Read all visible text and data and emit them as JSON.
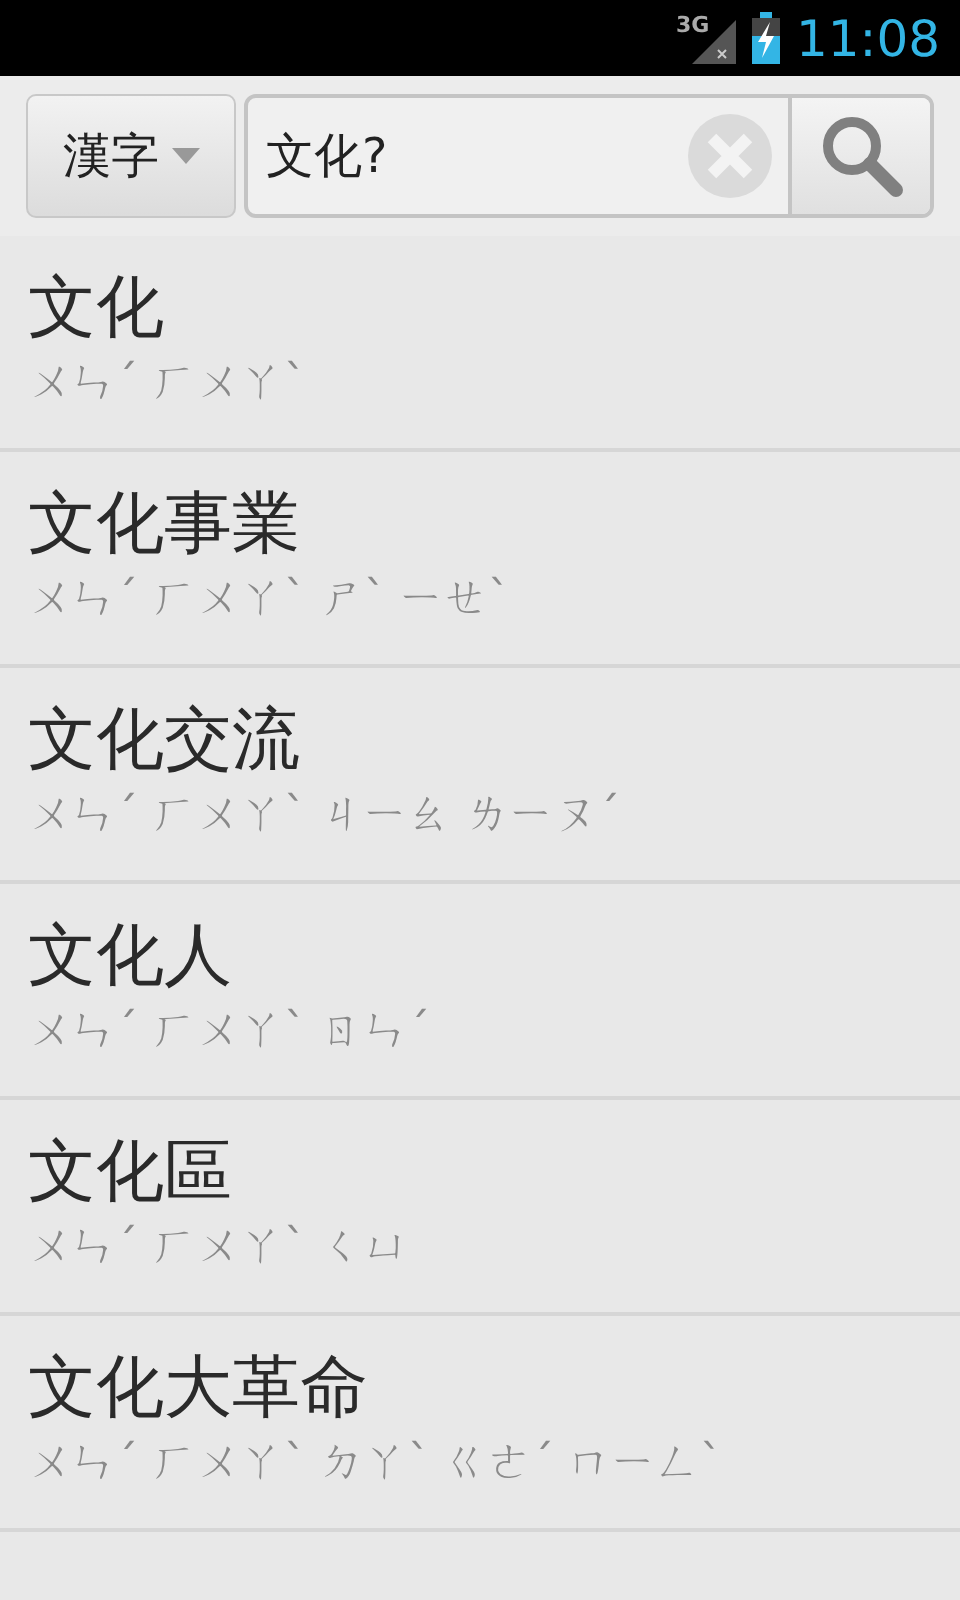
{
  "status_bar": {
    "network": "3G",
    "time": "11:08"
  },
  "search": {
    "mode": "漢字",
    "value": "文化?"
  },
  "results": [
    {
      "word": "文化",
      "reading": "ㄨㄣˊ ㄏㄨㄚˋ"
    },
    {
      "word": "文化事業",
      "reading": "ㄨㄣˊ ㄏㄨㄚˋ ㄕˋ ㄧㄝˋ"
    },
    {
      "word": "文化交流",
      "reading": "ㄨㄣˊ ㄏㄨㄚˋ ㄐㄧㄠ ㄌㄧㄡˊ"
    },
    {
      "word": "文化人",
      "reading": "ㄨㄣˊ ㄏㄨㄚˋ ㄖㄣˊ"
    },
    {
      "word": "文化區",
      "reading": "ㄨㄣˊ ㄏㄨㄚˋ ㄑㄩ"
    },
    {
      "word": "文化大革命",
      "reading": "ㄨㄣˊ ㄏㄨㄚˋ ㄉㄚˋ ㄍㄜˊ ㄇㄧㄥˋ"
    }
  ]
}
